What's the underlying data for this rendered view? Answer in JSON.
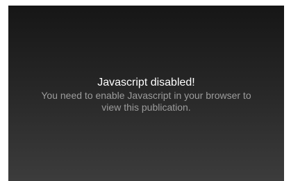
{
  "notice": {
    "title": "Javascript disabled!",
    "line1": "You need to enable Javascript in your browser to",
    "line2": "view this publication."
  },
  "colors": {
    "panel_top": "#161616",
    "panel_bottom": "#3c3c3c",
    "title": "#ffffff",
    "body": "#9c9c9c"
  }
}
